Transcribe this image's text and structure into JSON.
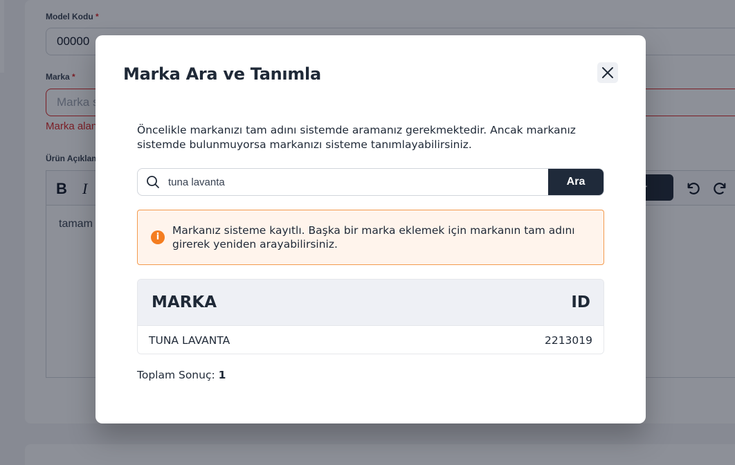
{
  "background_form": {
    "model_kodu_label": "Model Kodu",
    "required_mark": "*",
    "model_kodu_value": "00000",
    "marka_label": "Marka",
    "marka_placeholder": "Marka s",
    "marka_error": "Marka alan",
    "urun_aciklama_label": "Ürün Açıklam",
    "toolbar": {
      "bold": "B",
      "italic": "I",
      "button_label": "ter"
    },
    "editor_text": "tamam"
  },
  "modal": {
    "title": "Marka Ara ve Tanımla",
    "close_icon": "close-icon",
    "description": "Öncelikle markanızı tam adını sistemde aramanız gerekmektedir. Ancak markanız sistemde bulunmuyorsa markanızı sisteme tanımlayabilirsiniz.",
    "search": {
      "value": "tuna lavanta",
      "button_label": "Ara",
      "icon": "search-icon"
    },
    "alert": {
      "icon": "info-icon",
      "icon_glyph": "i",
      "text": "Markanız sisteme kayıtlı. Başka bir marka eklemek için markanın tam adını girerek yeniden arayabilirsiniz."
    },
    "table": {
      "headers": [
        "MARKA",
        "ID"
      ],
      "rows": [
        {
          "marka": "TUNA LAVANTA",
          "id": "2213019"
        }
      ]
    },
    "total": {
      "label": "Toplam Sonuç:",
      "value": "1"
    }
  },
  "colors": {
    "primary_dark": "#1f2a3a",
    "alert_bg": "#fff4ec",
    "alert_border": "#f39a4d",
    "alert_icon": "#f47d20",
    "error": "#dc2626"
  }
}
